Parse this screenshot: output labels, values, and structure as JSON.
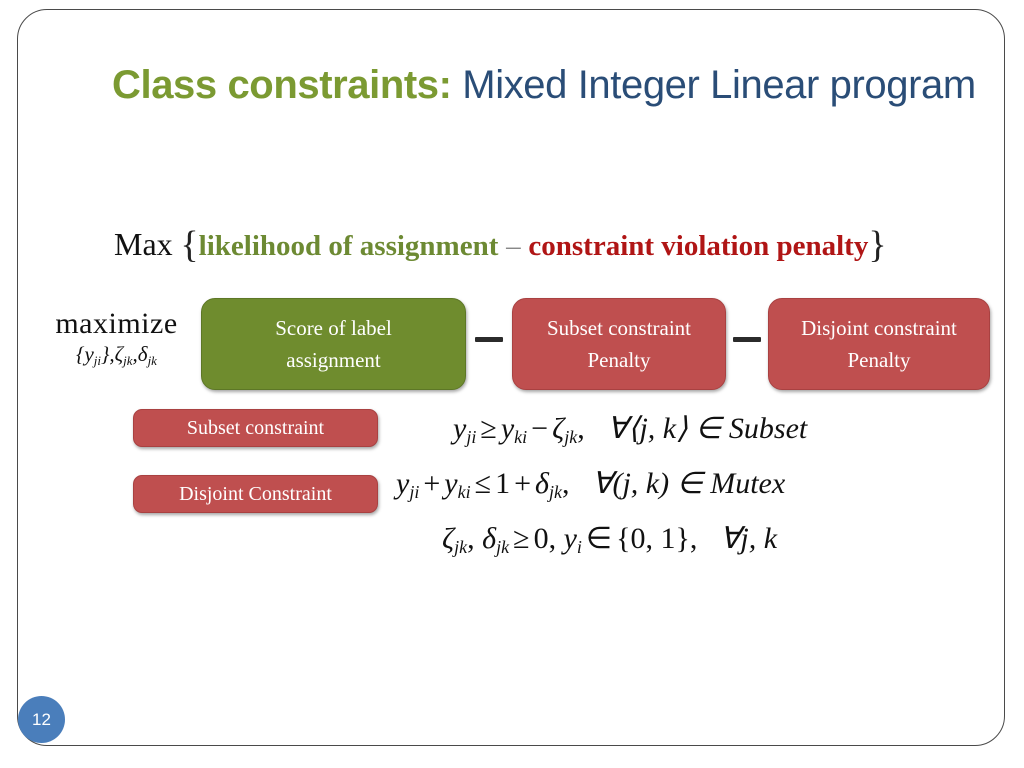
{
  "slide": {
    "page_number": "12",
    "accent_colors": {
      "title_green": "#7b9a32",
      "title_blue": "#2a4d77",
      "box_green": "#6f8c2e",
      "box_red": "#bf4f4f",
      "penalty_red": "#b01515",
      "likelihood_green": "#6d8a33",
      "badge_blue": "#4a7ebb",
      "frame_gray": "#4a4a4a"
    }
  },
  "title": {
    "highlight": "Class constraints:",
    "rest": " Mixed Integer Linear program"
  },
  "objective_text": {
    "max_word": "Max",
    "open_brace": "{",
    "likelihood": "likelihood of assignment",
    "minus": "–",
    "penalty": "constraint violation penalty",
    "close_brace": "}"
  },
  "maximize": {
    "word": "maximize",
    "subscript_prefix": "{y",
    "subscript_ji": "ji",
    "subscript_mid": "},ζ",
    "subscript_jk1": "jk",
    "subscript_mid2": ",δ",
    "subscript_jk2": "jk"
  },
  "objective_boxes": [
    {
      "name": "score-of-label-assignment",
      "line1": "Score of label",
      "line2": "assignment",
      "color": "#6f8c2e"
    },
    {
      "name": "subset-constraint-penalty",
      "line1": "Subset constraint",
      "line2": "Penalty",
      "color": "#bf4f4f"
    },
    {
      "name": "disjoint-constraint-penalty",
      "line1": "Disjoint constraint",
      "line2": "Penalty",
      "color": "#bf4f4f"
    }
  ],
  "operators": {
    "minus_1": "−",
    "minus_2": "−"
  },
  "constraint_tags": [
    {
      "name": "subset-constraint",
      "label": "Subset constraint"
    },
    {
      "name": "disjoint-constraint",
      "label": "Disjoint Constraint"
    }
  ],
  "equations": [
    {
      "name": "subset-constraint-equation",
      "plain": "y_ji ≥ y_ki − ζ_jk,  ∀⟨j, k⟩ ∈ Subset",
      "parts": {
        "lhs_var": "y",
        "lhs_sub": "ji",
        "rel": "≥",
        "rhs_var": "y",
        "rhs_sub": "ki",
        "op": "−",
        "slack_var": "ζ",
        "slack_sub": "jk",
        "comma": ",",
        "quantifier": "∀⟨j, k⟩ ∈ Subset"
      }
    },
    {
      "name": "mutex-constraint-equation",
      "plain": "y_ji + y_ki ≤ 1 + δ_jk,  ∀(j, k) ∈ Mutex",
      "parts": {
        "lhs_var": "y",
        "lhs_sub": "ji",
        "op1": "+",
        "rhs_var": "y",
        "rhs_sub": "ki",
        "rel": "≤",
        "one": "1",
        "op2": "+",
        "slack_var": "δ",
        "slack_sub": "jk",
        "comma": ",",
        "quantifier": "∀(j, k) ∈ Mutex"
      }
    },
    {
      "name": "domain-constraint-equation",
      "plain": "ζ_jk, δ_jk ≥ 0,  y_i ∈ {0, 1},  ∀j, k",
      "parts": {
        "zeta": "ζ",
        "zeta_sub": "jk",
        "comma1": ",",
        "delta": "δ",
        "delta_sub": "jk",
        "rel": "≥",
        "zero": "0,",
        "y_var": "y",
        "y_sub": "i",
        "member": "∈",
        "set": "{0, 1},",
        "quantifier": "∀j, k"
      }
    }
  ]
}
